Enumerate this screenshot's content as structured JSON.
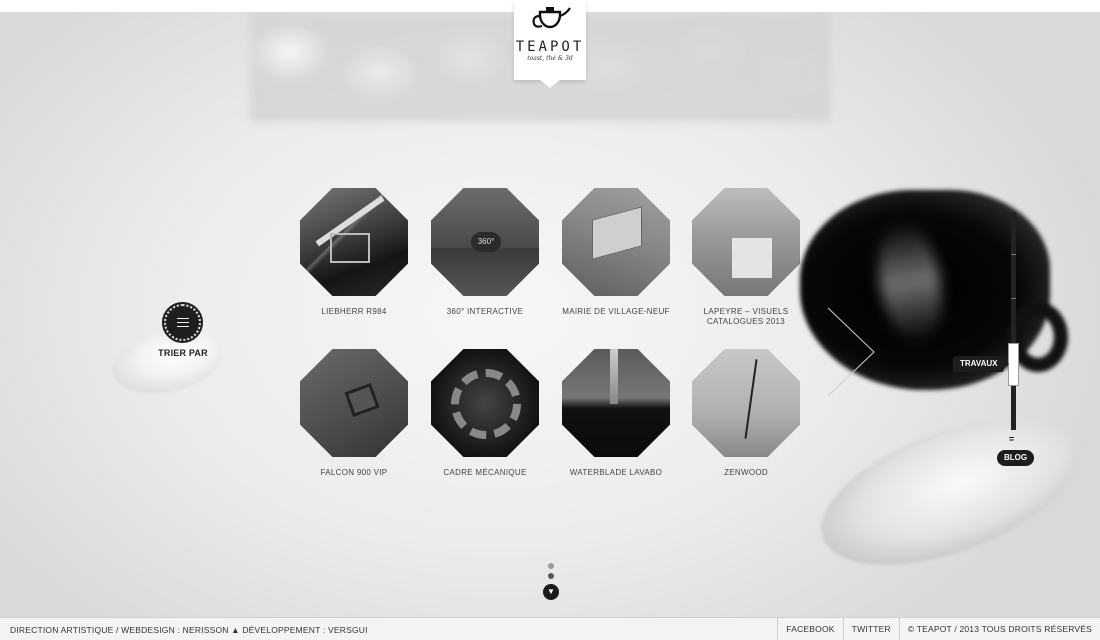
{
  "brand": {
    "name": "TEAPOT",
    "tagline": "toast, thé & 3d"
  },
  "sort": {
    "label": "TRIER PAR",
    "icon": "menu-icon"
  },
  "projects": [
    {
      "title": "LIEBHERR R984"
    },
    {
      "title": "360° INTERACTIVE",
      "badge": "360°"
    },
    {
      "title": "MAIRIE DE VILLAGE-NEUF"
    },
    {
      "title": "LAPEYRE – VISUELS CATALOGUES 2013"
    },
    {
      "title": "FALCON 900 VIP"
    },
    {
      "title": "CADRE MÉCANIQUE"
    },
    {
      "title": "WATERBLADE LAVABO"
    },
    {
      "title": "ZENWOOD"
    }
  ],
  "side_nav": {
    "travaux_label": "TRAVAUX",
    "blog_label": "BLOG",
    "eq_symbol": "="
  },
  "pagination": {
    "pages": 2,
    "current": 2,
    "scroll_icon": "chevron-down-icon"
  },
  "footer": {
    "credits": "DIRECTION ARTISTIQUE / WEBDESIGN : NERISSON ▲ DÉVELOPPEMENT : VERSGUI",
    "facebook": "FACEBOOK",
    "twitter": "TWITTER",
    "copyright": "© TEAPOT / 2013 TOUS DROITS RÉSERVÉS"
  },
  "colors": {
    "ink": "#1d1d1d",
    "background": "#ececec",
    "label": "#444444"
  }
}
